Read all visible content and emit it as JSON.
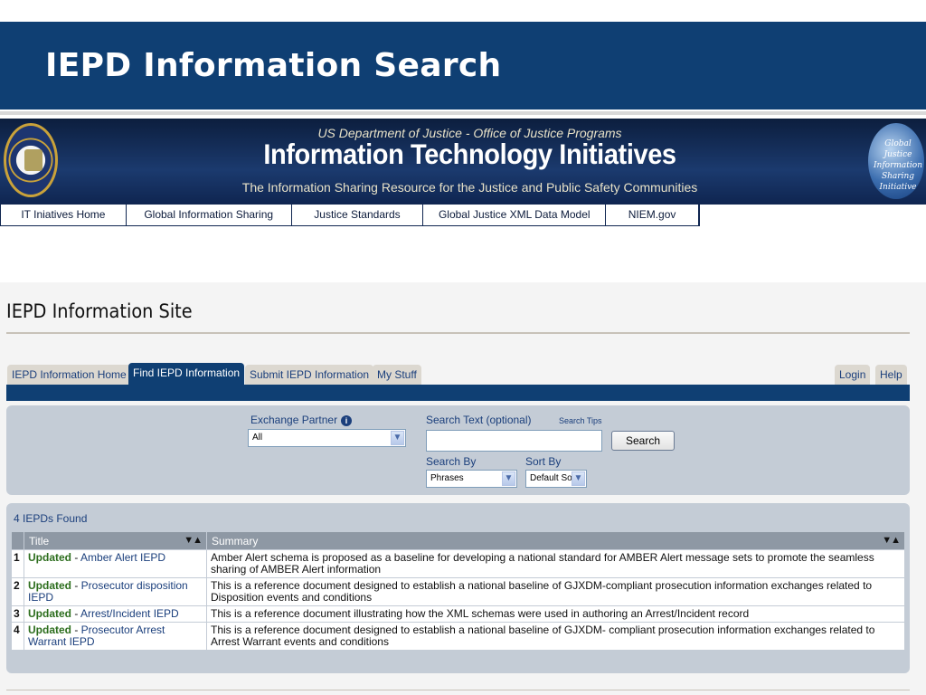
{
  "slide": {
    "title": "IEPD Information Search"
  },
  "banner": {
    "top_line": "US Department of Justice - Office of Justice Programs",
    "main_line": "Information Technology Initiatives",
    "sub_line": "The Information Sharing Resource for the Justice and Public Safety Communities",
    "globe_text": [
      "Global Justice",
      "Information",
      "Sharing",
      "Initiative"
    ],
    "nav": [
      {
        "label": "IT Iniatives Home"
      },
      {
        "label": "Global Information Sharing"
      },
      {
        "label": "Justice Standards"
      },
      {
        "label": "Global Justice XML Data Model"
      },
      {
        "label": "NIEM.gov"
      }
    ]
  },
  "site": {
    "title": "IEPD Information Site"
  },
  "tabs": {
    "left": [
      {
        "label": "IEPD Information Home",
        "active": false
      },
      {
        "label": "Find IEPD Information",
        "active": true
      },
      {
        "label": "Submit IEPD Information",
        "active": false
      },
      {
        "label": "My Stuff",
        "active": false
      }
    ],
    "right": [
      {
        "label": "Login"
      },
      {
        "label": "Help"
      }
    ]
  },
  "search": {
    "exchange_partner_label": "Exchange Partner",
    "exchange_partner_value": "All",
    "search_text_label": "Search Text (optional)",
    "search_tips_label": "Search Tips",
    "search_text_value": "",
    "search_button_label": "Search",
    "search_by_label": "Search By",
    "search_by_value": "Phrases",
    "sort_by_label": "Sort By",
    "sort_by_value": "Default Sort"
  },
  "results": {
    "count_label": "4 IEPDs Found",
    "columns": {
      "title": "Title",
      "summary": "Summary"
    },
    "rows": [
      {
        "index": "1",
        "status": "Updated",
        "sep": " - ",
        "title": "Amber Alert IEPD",
        "summary": "Amber Alert schema is proposed as a baseline for developing a national standard for AMBER Alert message sets to promote the seamless sharing of AMBER Alert information"
      },
      {
        "index": "2",
        "status": "Updated",
        "sep": " - ",
        "title": "Prosecutor disposition IEPD",
        "summary": "This is a reference document designed to establish a national baseline of GJXDM-compliant prosecution information exchanges related to Disposition events and conditions"
      },
      {
        "index": "3",
        "status": "Updated",
        "sep": " - ",
        "title": "Arrest/Incident IEPD",
        "summary": "This is a reference document illustrating how the XML schemas were used in authoring an Arrest/Incident record"
      },
      {
        "index": "4",
        "status": "Updated",
        "sep": " - ",
        "title": "Prosecutor Arrest Warrant IEPD",
        "summary": "This is a reference document designed to establish a national baseline of GJXDM- compliant prosecution information exchanges related to Arrest Warrant events and conditions"
      }
    ]
  },
  "icons": {
    "info": "info-icon",
    "dropdown": "chevron-down-icon",
    "sort": "sort-arrows-icon"
  },
  "colors": {
    "title_bar": "#0f3f73",
    "updated": "#2d6e1e",
    "link": "#1b3f7c",
    "panel": "#c4ccd6"
  }
}
